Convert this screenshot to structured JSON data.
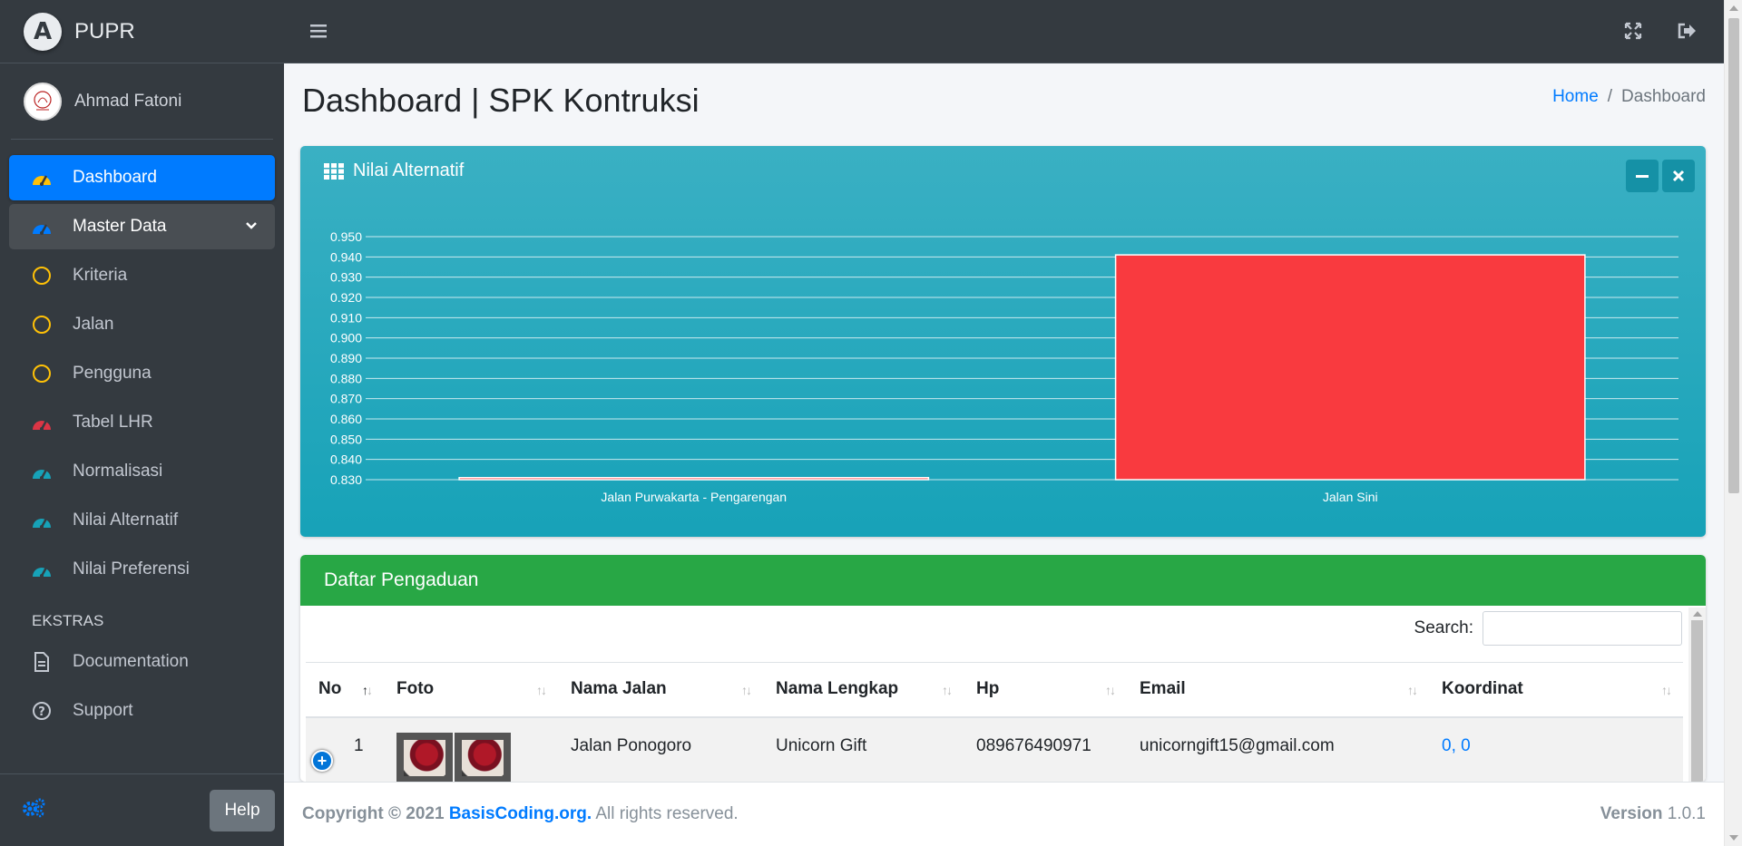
{
  "brand": {
    "logo_letter": "A",
    "name": "PUPR"
  },
  "user": {
    "name": "Ahmad Fatoni"
  },
  "nav": {
    "items": [
      {
        "label": "Dashboard",
        "icon": "tachometer-icon",
        "color": "#ffc107"
      },
      {
        "label": "Master Data",
        "icon": "tachometer-icon",
        "color": "#007bff"
      },
      {
        "label": "Kriteria",
        "icon": "circle-icon",
        "color": "#ffc107"
      },
      {
        "label": "Jalan",
        "icon": "circle-icon",
        "color": "#ffc107"
      },
      {
        "label": "Pengguna",
        "icon": "circle-icon",
        "color": "#ffc107"
      },
      {
        "label": "Tabel LHR",
        "icon": "tachometer-icon",
        "color": "#dc3545"
      },
      {
        "label": "Normalisasi",
        "icon": "tachometer-icon",
        "color": "#17a2b8"
      },
      {
        "label": "Nilai Alternatif",
        "icon": "tachometer-icon",
        "color": "#17a2b8"
      },
      {
        "label": "Nilai Preferensi",
        "icon": "tachometer-icon",
        "color": "#17a2b8"
      }
    ],
    "header": "EKSTRAS",
    "extras": [
      {
        "label": "Documentation",
        "icon": "file-icon"
      },
      {
        "label": "Support",
        "icon": "question-circle-icon"
      }
    ]
  },
  "sidebar_footer": {
    "help_label": "Help"
  },
  "page": {
    "title": "Dashboard | SPK Kontruksi",
    "breadcrumb": {
      "home": "Home",
      "current": "Dashboard"
    }
  },
  "chart_card": {
    "title": "Nilai Alternatif"
  },
  "chart_data": {
    "type": "bar",
    "categories": [
      "Jalan Purwakarta - Pengarengan",
      "Jalan Sini"
    ],
    "values": [
      0.831,
      0.941
    ],
    "ylim": [
      0.83,
      0.95
    ],
    "yticks": [
      "0.950",
      "0.940",
      "0.930",
      "0.920",
      "0.910",
      "0.900",
      "0.890",
      "0.880",
      "0.870",
      "0.860",
      "0.850",
      "0.840",
      "0.830"
    ],
    "bar_color": "#f93a3f",
    "grid": true
  },
  "table_card": {
    "title": "Daftar Pengaduan",
    "search_label": "Search:",
    "columns": [
      "No",
      "Foto",
      "Nama Jalan",
      "Nama Lengkap",
      "Hp",
      "Email",
      "Koordinat"
    ],
    "rows": [
      {
        "no": "1",
        "nama_jalan": "Jalan Ponogoro",
        "nama_lengkap": "Unicorn Gift",
        "hp": "089676490971",
        "email": "unicorngift15@gmail.com",
        "koordinat": "0, 0"
      }
    ]
  },
  "footer": {
    "copyright_prefix": "Copyright © 2021",
    "site": "BasisCoding.org.",
    "rights": "All rights reserved.",
    "version_label": "Version",
    "version": "1.0.1"
  }
}
